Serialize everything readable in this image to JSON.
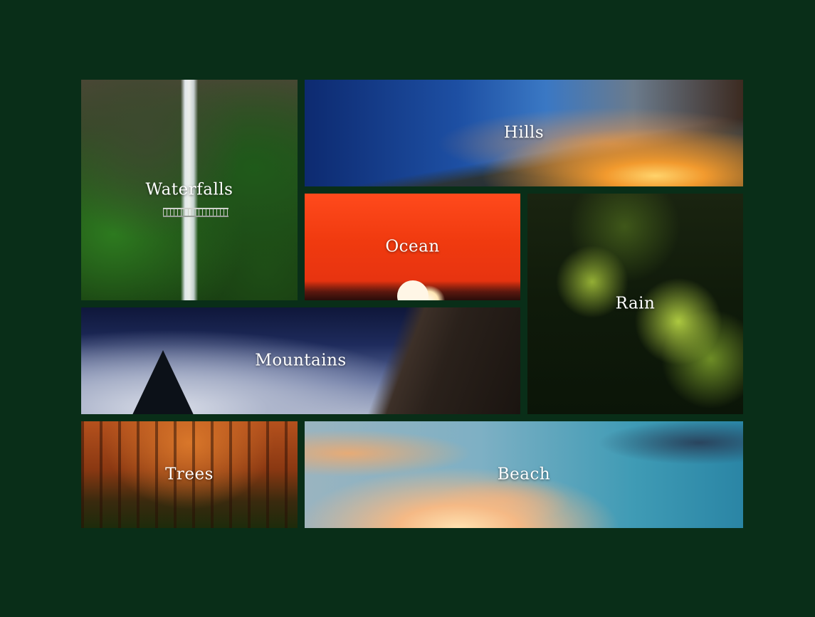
{
  "page": {
    "background_color": "#092e18",
    "label_color": "#ffffff"
  },
  "gallery": {
    "tiles": [
      {
        "id": "waterfalls",
        "label": "Waterfalls",
        "image": "waterfall-forest-bridge-photo"
      },
      {
        "id": "hills",
        "label": "Hills",
        "image": "sunset-clouds-over-hills-photo"
      },
      {
        "id": "ocean",
        "label": "Ocean",
        "image": "red-sunset-over-ocean-photo"
      },
      {
        "id": "rain",
        "label": "Rain",
        "image": "green-leaves-rain-bokeh-photo"
      },
      {
        "id": "mountains",
        "label": "Mountains",
        "image": "night-sky-cliff-silhouette-photo"
      },
      {
        "id": "trees",
        "label": "Trees",
        "image": "autumn-forest-photo"
      },
      {
        "id": "beach",
        "label": "Beach",
        "image": "beach-sky-clouds-photo"
      }
    ]
  }
}
